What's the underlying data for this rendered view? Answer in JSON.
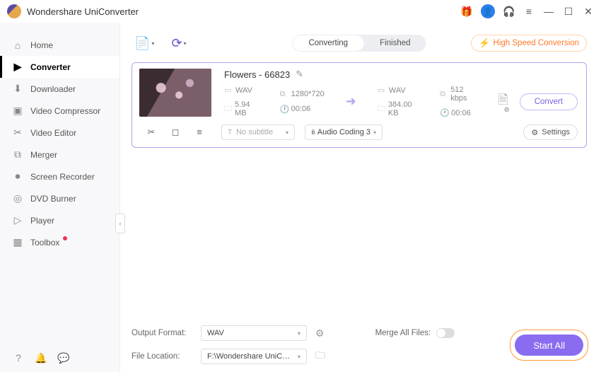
{
  "title": "Wondershare UniConverter",
  "sidebar": {
    "items": [
      {
        "label": "Home"
      },
      {
        "label": "Converter"
      },
      {
        "label": "Downloader"
      },
      {
        "label": "Video Compressor"
      },
      {
        "label": "Video Editor"
      },
      {
        "label": "Merger"
      },
      {
        "label": "Screen Recorder"
      },
      {
        "label": "DVD Burner"
      },
      {
        "label": "Player"
      },
      {
        "label": "Toolbox"
      }
    ]
  },
  "tabs": {
    "converting": "Converting",
    "finished": "Finished"
  },
  "high_speed": "High Speed Conversion",
  "file": {
    "name": "Flowers - 66823",
    "src": {
      "fmt": "WAV",
      "res": "1280*720",
      "size": "5.94 MB",
      "dur": "00:06"
    },
    "dst": {
      "fmt": "WAV",
      "bitrate": "512 kbps",
      "size": "384.00 KB",
      "dur": "00:06"
    },
    "subtitle_placeholder": "No subtitle",
    "audio_codec": "Audio Coding 3",
    "settings_label": "Settings",
    "convert_label": "Convert"
  },
  "bottom": {
    "output_format_label": "Output Format:",
    "output_format_value": "WAV",
    "file_location_label": "File Location:",
    "file_location_value": "F:\\Wondershare UniConverter",
    "merge_label": "Merge All Files:",
    "start_all": "Start All"
  }
}
